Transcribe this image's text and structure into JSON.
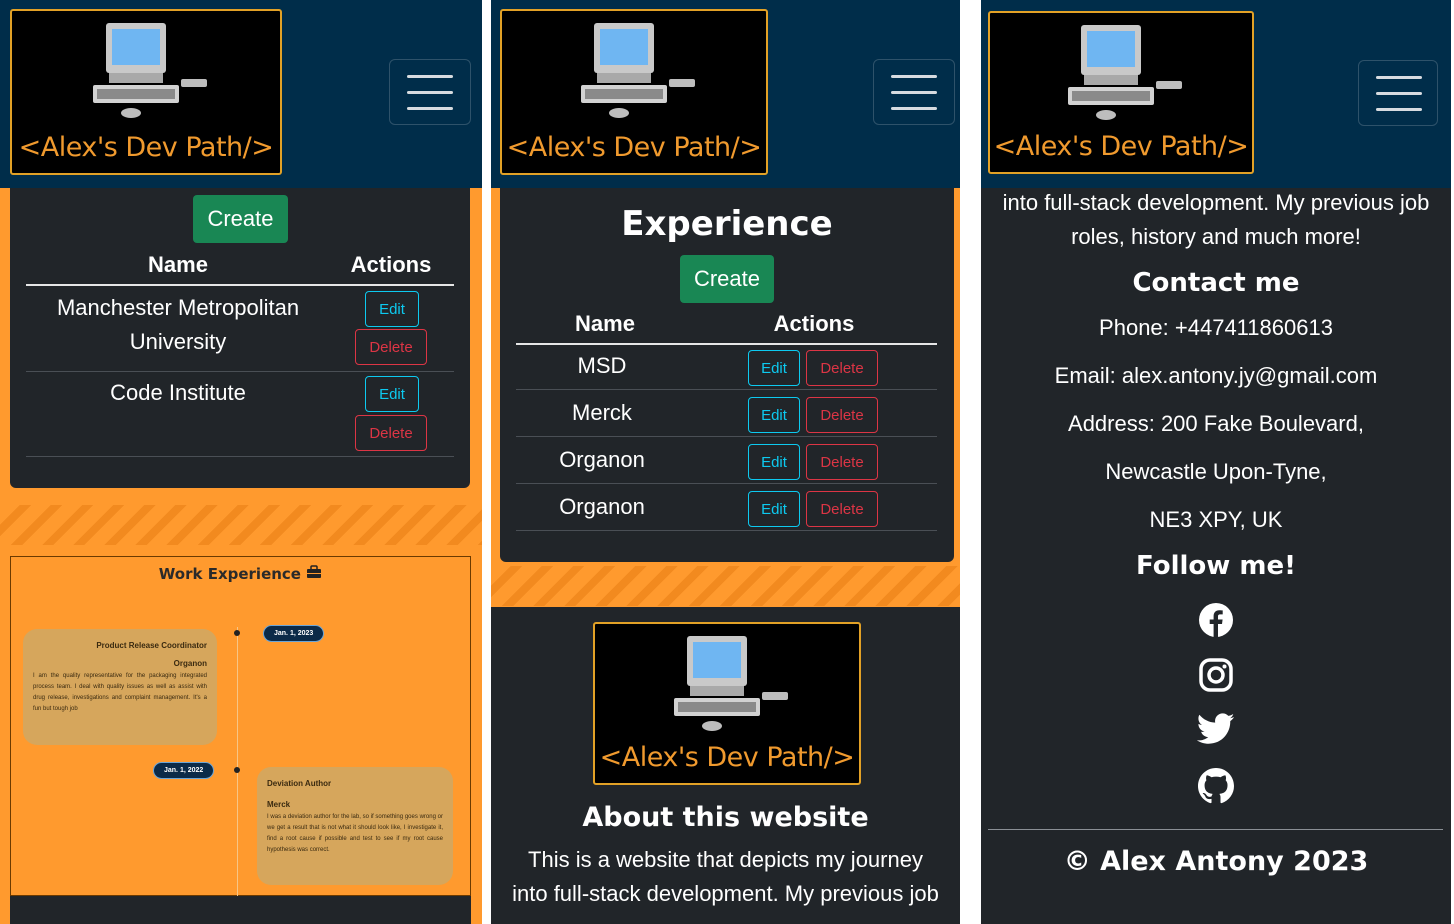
{
  "brand": {
    "logo_text": "<Alex's Dev Path/>"
  },
  "panel1": {
    "create_label": "Create",
    "columns": [
      "Name",
      "Actions"
    ],
    "rows": [
      {
        "name_line1": "Manchester Metropolitan",
        "name_line2": "University",
        "edit": "Edit",
        "delete": "Delete"
      },
      {
        "name_line1": "Code Institute",
        "name_line2": "",
        "edit": "Edit",
        "delete": "Delete"
      }
    ],
    "timeline": {
      "title": "Work Experience",
      "entries": [
        {
          "date": "Jan. 1, 2023",
          "role": "Product Release Coordinator",
          "company": "Organon",
          "desc": "I am the quality representative for the packaging integrated process team. I deal with quality issues as well as assist with drug release, investigations and complaint management. It's a fun but tough job"
        },
        {
          "date": "Jan. 1, 2022",
          "role": "Deviation Author",
          "company": "Merck",
          "desc": "I was a deviation author for the lab, so if something goes wrong or we get a result that is not what it should look like, I investigate it, find a root cause if possible and test to see if my root cause hypothesis was correct."
        }
      ]
    }
  },
  "panel2": {
    "heading": "Experience",
    "create_label": "Create",
    "columns": [
      "Name",
      "Actions"
    ],
    "rows": [
      {
        "name": "MSD",
        "edit": "Edit",
        "delete": "Delete"
      },
      {
        "name": "Merck",
        "edit": "Edit",
        "delete": "Delete"
      },
      {
        "name": "Organon",
        "edit": "Edit",
        "delete": "Delete"
      },
      {
        "name": "Organon",
        "edit": "Edit",
        "delete": "Delete"
      }
    ],
    "about_title": "About this website",
    "about_line1": "This is a website that depicts my journey",
    "about_line2": "into full-stack development. My previous job"
  },
  "panel3": {
    "about_line3": "into full-stack development. My previous job",
    "about_line4": "roles, history and much more!",
    "contact_title": "Contact me",
    "phone": "Phone: +447411860613",
    "email": "Email: alex.antony.jy@gmail.com",
    "address1": "Address: 200 Fake Boulevard,",
    "address2": "Newcastle Upon-Tyne,",
    "address3": "NE3 XPY, UK",
    "follow_title": "Follow me!",
    "social_icons": [
      "facebook-icon",
      "instagram-icon",
      "twitter-icon",
      "github-icon"
    ],
    "copyright": "© Alex Antony 2023"
  },
  "colors": {
    "navbar": "#002d4a",
    "dark": "#212529",
    "orange": "#ff9a2e",
    "green": "#198754",
    "info": "#0dcaf0",
    "danger": "#dc3545",
    "logo_gold": "#e2a126"
  }
}
